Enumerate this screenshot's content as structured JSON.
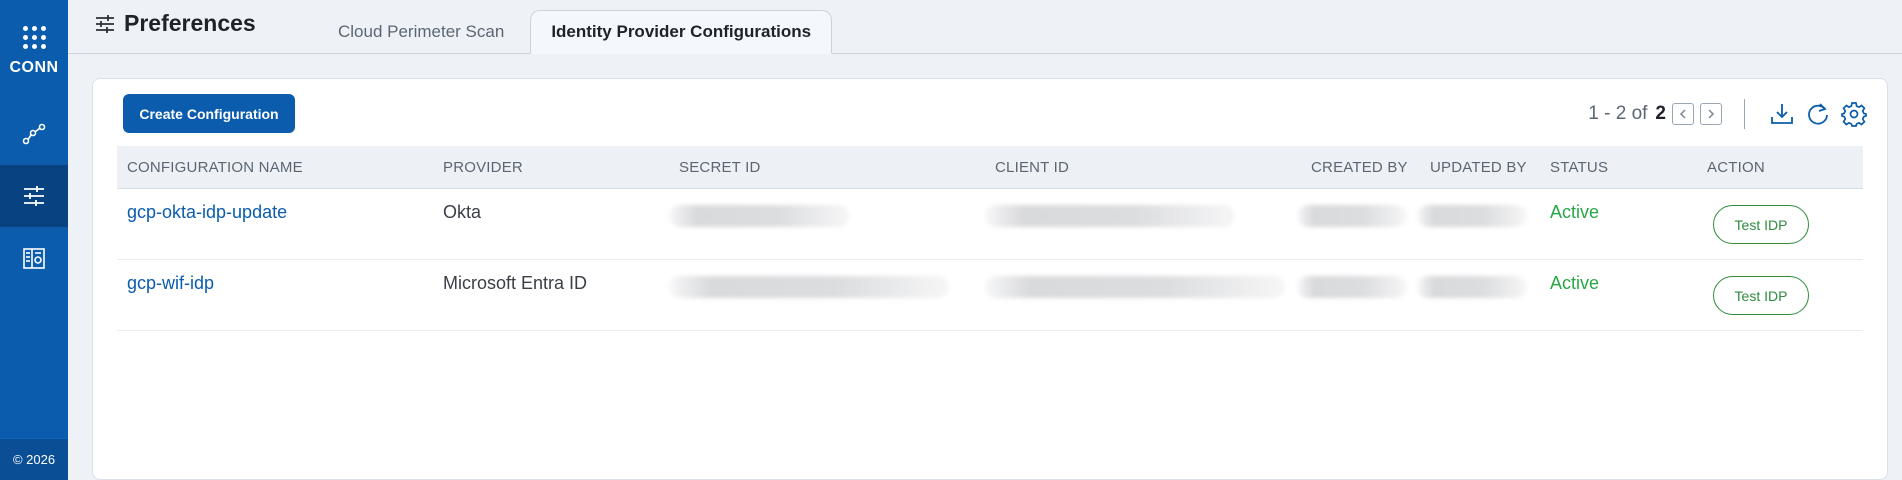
{
  "sidebar": {
    "brand": "CONN",
    "items": [
      {
        "name": "workflow-icon"
      },
      {
        "name": "sliders-icon"
      },
      {
        "name": "building-icon"
      }
    ],
    "copyright": "© 2026",
    "color": "#0b5cad"
  },
  "header": {
    "title": "Preferences",
    "tabs": [
      {
        "label": "Cloud Perimeter Scan",
        "active": false
      },
      {
        "label": "Identity Provider Configurations",
        "active": true
      }
    ]
  },
  "toolbar": {
    "create_label": "Create Configuration",
    "pager_range": "1 - 2 of",
    "pager_total": "2"
  },
  "table": {
    "columns": [
      "CONFIGURATION NAME",
      "PROVIDER",
      "SECRET ID",
      "CLIENT ID",
      "CREATED BY",
      "UPDATED BY",
      "STATUS",
      "ACTION"
    ],
    "rows": [
      {
        "name": "gcp-okta-idp-update",
        "provider": "Okta",
        "status": "Active",
        "action": "Test IDP"
      },
      {
        "name": "gcp-wif-idp",
        "provider": "Microsoft Entra ID",
        "status": "Active",
        "action": "Test IDP"
      }
    ]
  }
}
